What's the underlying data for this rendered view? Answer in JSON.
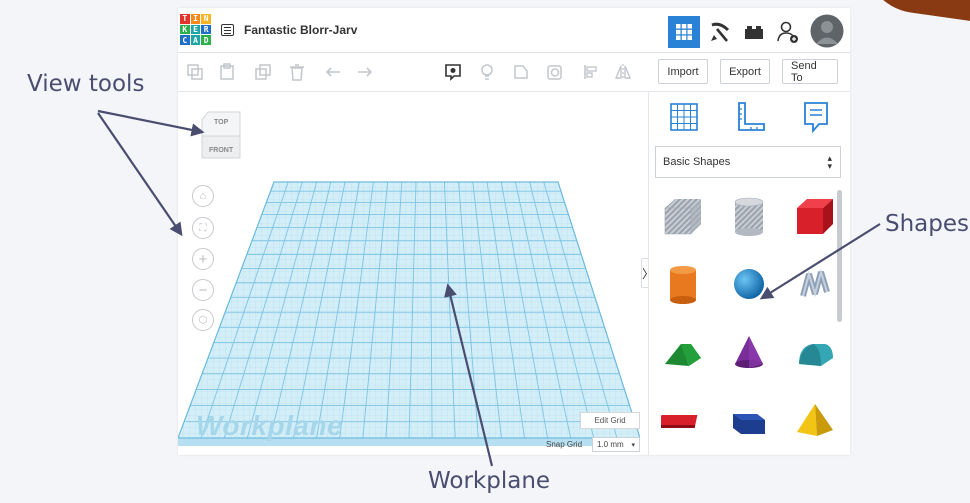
{
  "colors": {
    "accent": "#2a82d6",
    "annotation": "#4a4d70",
    "grid_fill": "#d4eef8",
    "grid_line": "#7cc4e3"
  },
  "annotations": {
    "view_tools": "View tools",
    "shapes": "Shapes",
    "workplane": "Workplane"
  },
  "app": {
    "logo_letters": [
      "T",
      "I",
      "N",
      "K",
      "E",
      "R",
      "C",
      "A",
      "D"
    ],
    "project_title": "Fantastic Blorr-Jarv"
  },
  "top_buttons": [
    {
      "icon": "3d-design-grid-icon",
      "active": true
    },
    {
      "icon": "codeblocks-pickaxe-icon"
    },
    {
      "icon": "bricks-icon"
    },
    {
      "icon": "add-user-icon"
    },
    {
      "icon": "avatar"
    }
  ],
  "toolbar": {
    "edit_icons": [
      "copy-icon",
      "paste-icon",
      "duplicate-icon",
      "delete-icon",
      "undo-icon",
      "redo-icon"
    ],
    "view_icons": [
      "notes-icon",
      "light-bulb-icon",
      "shape-outline-icon",
      "group-icon",
      "align-icon",
      "mirror-icon"
    ],
    "import_label": "Import",
    "export_label": "Export",
    "send_to_label": "Send To"
  },
  "viewcube": {
    "top_label": "TOP",
    "front_label": "FRONT"
  },
  "view_tools": [
    "home-view-icon",
    "fit-all-icon",
    "zoom-in-icon",
    "zoom-out-icon",
    "ortho-view-icon"
  ],
  "workplane": {
    "label": "Workplane",
    "edit_grid_label": "Edit Grid",
    "snap_grid_label": "Snap Grid",
    "snap_grid_value": "1.0 mm"
  },
  "panel": {
    "tools": [
      "workplane-grid-icon",
      "ruler-icon",
      "notes-icon"
    ],
    "category": "Basic Shapes",
    "shapes": [
      {
        "name": "box-hole-shape",
        "color": "#a9b0bb"
      },
      {
        "name": "cylinder-hole-shape",
        "color": "#b4bac3"
      },
      {
        "name": "box-shape",
        "color": "#d8202b"
      },
      {
        "name": "cylinder-shape",
        "color": "#e8791e"
      },
      {
        "name": "sphere-shape",
        "color": "#1687cf"
      },
      {
        "name": "scribble-shape",
        "color": "#8fa1b8"
      },
      {
        "name": "roof-shape",
        "color": "#23a03c"
      },
      {
        "name": "cone-shape",
        "color": "#7a2e99"
      },
      {
        "name": "round-roof-shape",
        "color": "#35a6b4"
      },
      {
        "name": "text-shape",
        "color": "#d8202b"
      },
      {
        "name": "half-box-shape",
        "color": "#1d3d8f"
      },
      {
        "name": "pyramid-shape",
        "color": "#f2c415"
      }
    ]
  }
}
